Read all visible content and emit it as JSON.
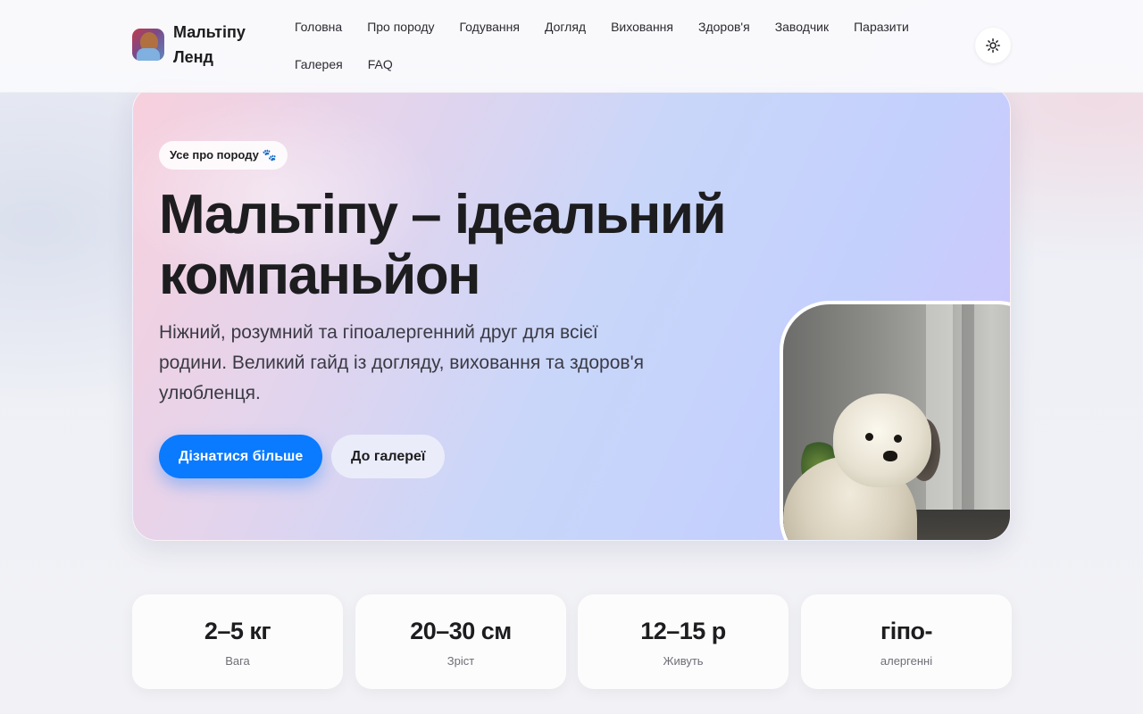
{
  "brand": {
    "name": "Мальтіпу Ленд"
  },
  "nav": {
    "items": [
      {
        "label": "Головна"
      },
      {
        "label": "Про породу"
      },
      {
        "label": "Годування"
      },
      {
        "label": "Догляд"
      },
      {
        "label": "Виховання"
      },
      {
        "label": "Здоров'я"
      },
      {
        "label": "Заводчик"
      },
      {
        "label": "Паразити"
      },
      {
        "label": "Галерея"
      },
      {
        "label": "FAQ"
      }
    ]
  },
  "hero": {
    "badge": "Усе про породу 🐾",
    "title": "Мальтіпу – ідеальний компаньйон",
    "subtitle": "Ніжний, розумний та гіпоалергенний друг для всієї родини. Великий гайд із догляду, виховання та здоров'я улюбленця.",
    "primary_button": "Дізнатися більше",
    "secondary_button": "До галереї"
  },
  "stats": [
    {
      "value": "2–5 кг",
      "label": "Вага"
    },
    {
      "value": "20–30 см",
      "label": "Зріст"
    },
    {
      "value": "12–15 р",
      "label": "Живуть"
    },
    {
      "value": "гіпо-",
      "label": "алергенні"
    }
  ],
  "colors": {
    "primary": "#0a7aff",
    "text": "#1d1d1f"
  },
  "icons": {
    "theme_toggle": "sun-icon"
  }
}
